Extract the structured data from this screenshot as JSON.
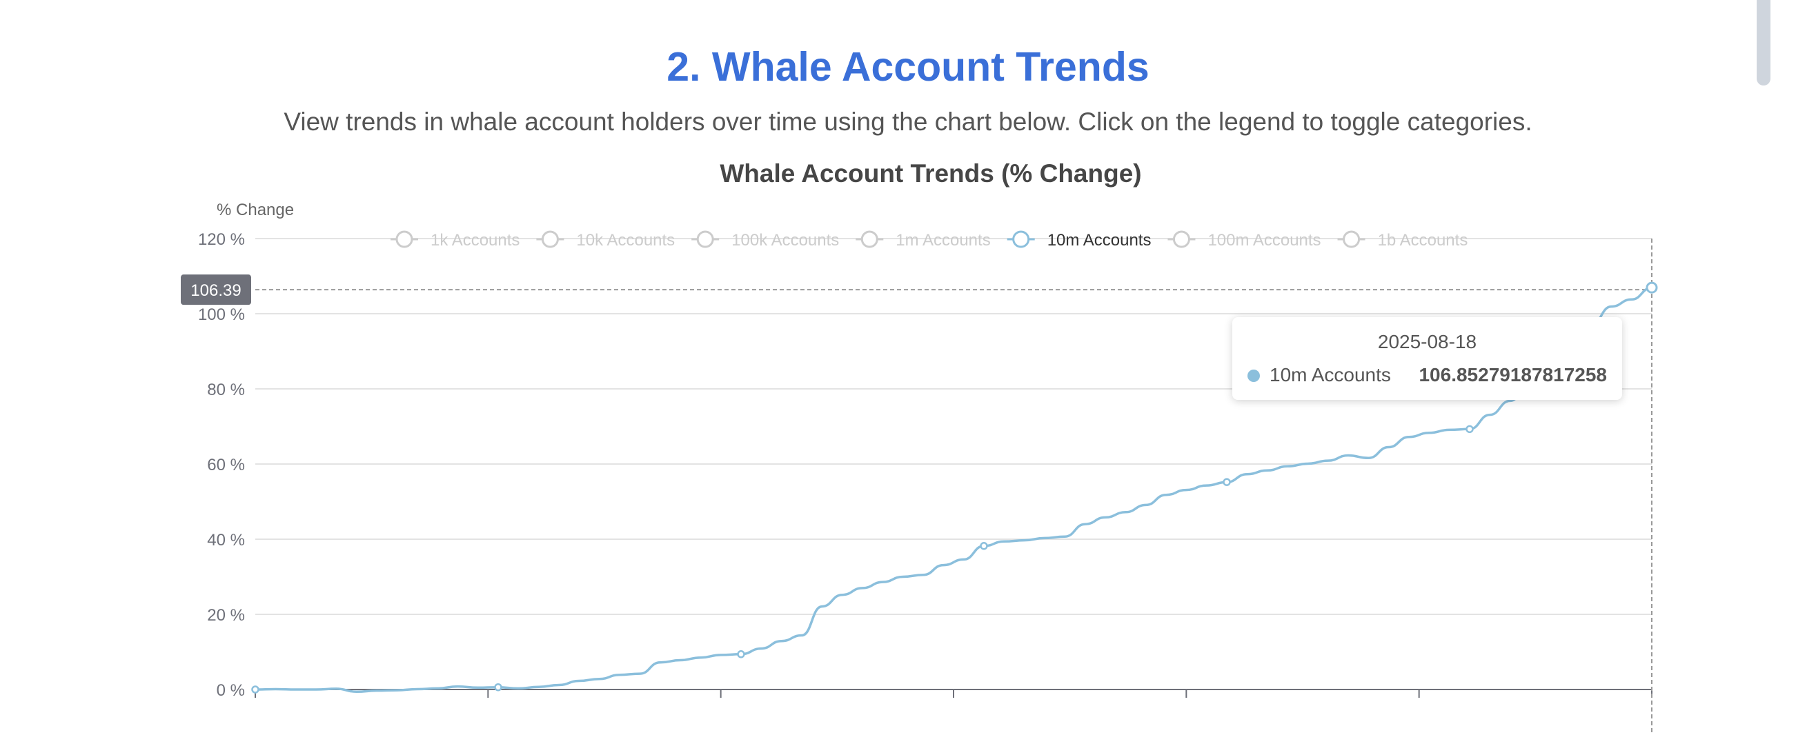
{
  "page": {
    "title": "2. Whale Account Trends",
    "subtitle": "View trends in whale account holders over time using the chart below. Click on the legend to toggle categories."
  },
  "colors": {
    "title": "#3a6fd8",
    "series": "#8bbfdc",
    "inactive_legend": "#cccccc",
    "axis_pointer_label_bg": "#6e7079"
  },
  "chart_data": {
    "type": "line",
    "title": "Whale Account Trends (% Change)",
    "ylabel": "% Change",
    "xlabel": "",
    "ylim": [
      0,
      120
    ],
    "y_ticks": [
      {
        "value": 120,
        "label": "120 %"
      },
      {
        "value": 100,
        "label": "100 %"
      },
      {
        "value": 80,
        "label": "80 %"
      },
      {
        "value": 60,
        "label": "60 %"
      },
      {
        "value": 40,
        "label": "40 %"
      },
      {
        "value": 20,
        "label": "20 %"
      },
      {
        "value": 0,
        "label": "0 %"
      }
    ],
    "grid": true,
    "legend_position": "top",
    "legend": [
      {
        "name": "1k Accounts",
        "active": false
      },
      {
        "name": "10k Accounts",
        "active": false
      },
      {
        "name": "100k Accounts",
        "active": false
      },
      {
        "name": "1m Accounts",
        "active": false
      },
      {
        "name": "10m Accounts",
        "active": true
      },
      {
        "name": "100m Accounts",
        "active": false
      },
      {
        "name": "1b Accounts",
        "active": false
      }
    ],
    "series": [
      {
        "name": "10m Accounts",
        "values": [
          0,
          0.1,
          0,
          0,
          0.2,
          -0.6,
          -0.3,
          -0.2,
          0.1,
          0.3,
          0.8,
          0.5,
          0.6,
          0.3,
          0.7,
          1.2,
          2.3,
          2.8,
          3.9,
          4.2,
          7.2,
          7.8,
          8.5,
          9.2,
          9.4,
          10.9,
          12.9,
          14.4,
          22.1,
          25.2,
          27.0,
          28.6,
          30.0,
          30.5,
          33.1,
          34.6,
          38.2,
          39.4,
          39.7,
          40.3,
          40.7,
          44.0,
          45.8,
          47.2,
          49.1,
          51.8,
          53.1,
          54.3,
          55.2,
          57.3,
          58.3,
          59.4,
          60.1,
          60.9,
          62.3,
          61.6,
          64.5,
          67.2,
          68.3,
          69.1,
          69.3,
          73.1,
          76.8,
          82.0,
          86.9,
          91.5,
          97.0,
          101.9,
          103.8,
          106.9
        ]
      }
    ],
    "x_tick_count": 6,
    "tooltip": {
      "date": "2025-08-18",
      "series": "10m Accounts",
      "value": "106.85279187817258"
    },
    "axis_pointer_label": "106.39",
    "axis_pointer_value": 106.39
  }
}
